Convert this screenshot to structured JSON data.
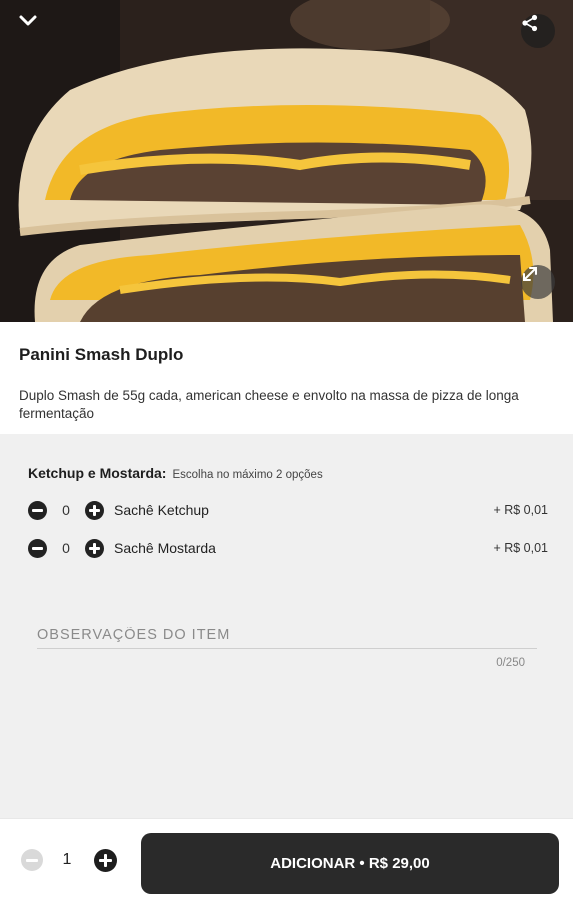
{
  "product": {
    "name": "Panini Smash Duplo",
    "description": "Duplo Smash de 55g cada, american cheese e envolto na massa de pizza de longa fermentação"
  },
  "option_group": {
    "title": "Ketchup e Mostarda:",
    "hint": "Escolha no máximo 2 opções",
    "items": [
      {
        "label": "Sachê Ketchup",
        "qty": "0",
        "price": "+ R$ 0,01"
      },
      {
        "label": "Sachê Mostarda",
        "qty": "0",
        "price": "+ R$ 0,01"
      }
    ]
  },
  "notes": {
    "placeholder": "OBSERVAÇÕES DO ITEM",
    "counter": "0/250"
  },
  "footer": {
    "qty": "1",
    "add_label": "ADICIONAR • R$ 29,00"
  },
  "icons": {
    "back": "chevron-down-icon",
    "share": "share-icon",
    "expand": "expand-icon"
  },
  "colors": {
    "accent": "#2a2a2a",
    "options_bg": "#f0f0f0",
    "cheese": "#f2b928"
  }
}
